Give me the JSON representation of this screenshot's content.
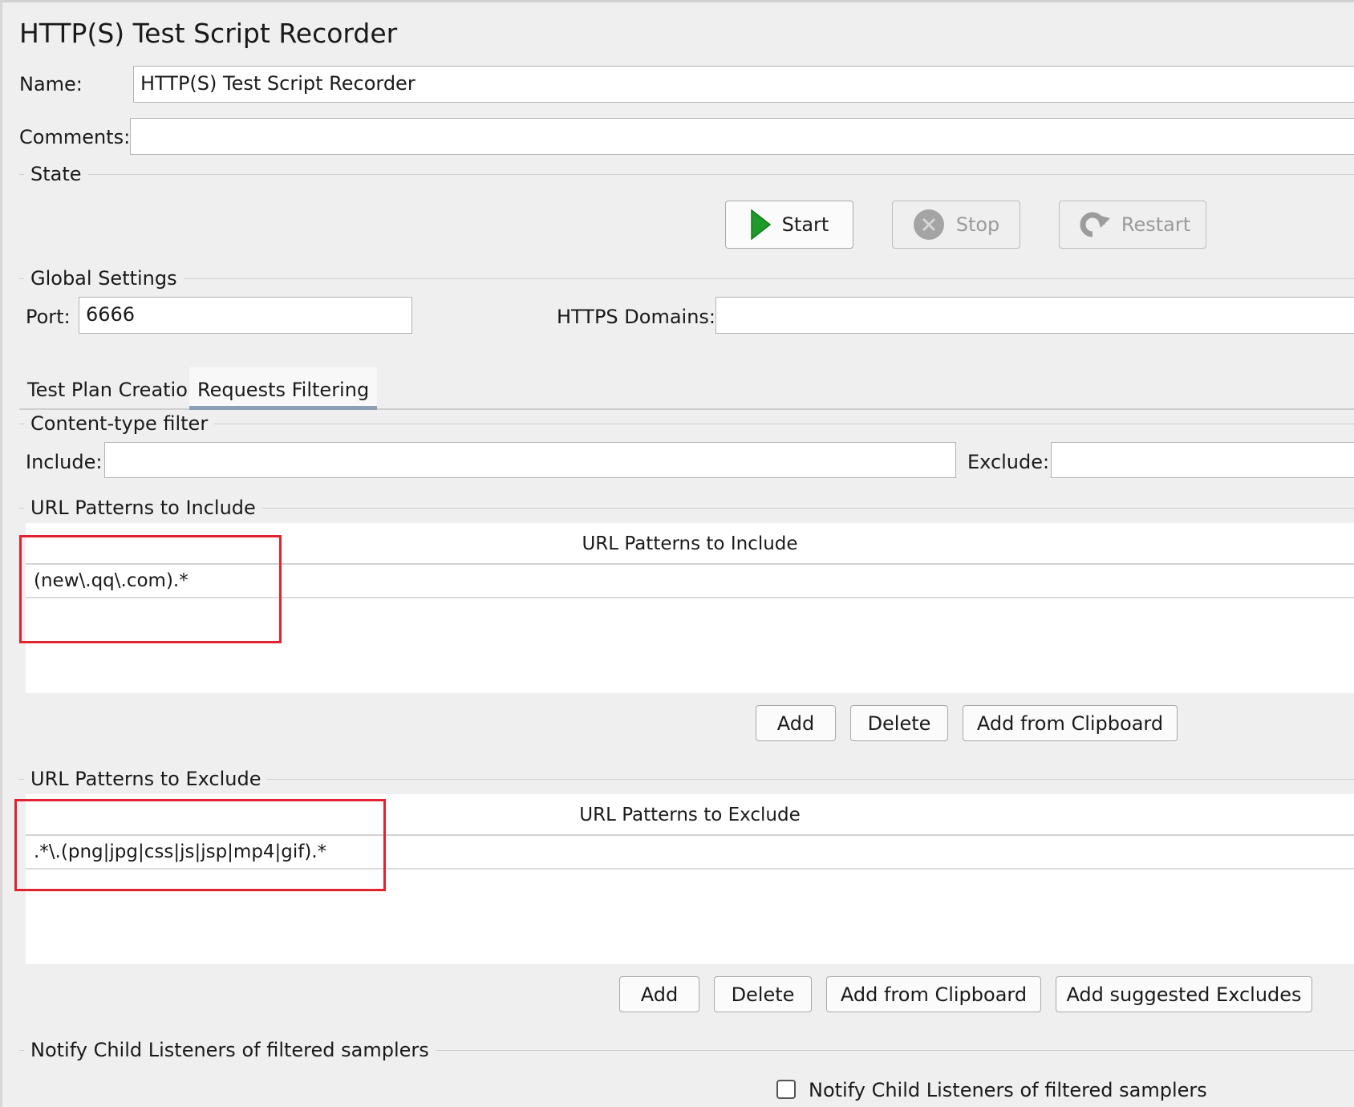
{
  "title": "HTTP(S) Test Script Recorder",
  "name_label": "Name:",
  "name_value": "HTTP(S) Test Script Recorder",
  "comments_label": "Comments:",
  "comments_value": "",
  "state": {
    "legend": "State",
    "start_label": "Start",
    "stop_label": "Stop",
    "restart_label": "Restart"
  },
  "global_settings": {
    "legend": "Global Settings",
    "port_label": "Port:",
    "port_value": "6666",
    "https_domains_label": "HTTPS Domains:",
    "https_domains_value": ""
  },
  "tabs": [
    {
      "label": "Test Plan Creation",
      "active": false
    },
    {
      "label": "Requests Filtering",
      "active": true
    }
  ],
  "content_type_filter": {
    "legend": "Content-type filter",
    "include_label": "Include:",
    "include_value": "",
    "exclude_label": "Exclude:",
    "exclude_value": ""
  },
  "include_patterns": {
    "legend": "URL Patterns to Include",
    "column_header": "URL Patterns to Include",
    "rows": [
      "(new\\.qq\\.com).*"
    ],
    "buttons": {
      "add": "Add",
      "delete": "Delete",
      "add_clipboard": "Add from Clipboard"
    }
  },
  "exclude_patterns": {
    "legend": "URL Patterns to Exclude",
    "column_header": "URL Patterns to Exclude",
    "rows": [
      ".*\\.(png|jpg|css|js|jsp|mp4|gif).*"
    ],
    "buttons": {
      "add": "Add",
      "delete": "Delete",
      "add_clipboard": "Add from Clipboard",
      "add_suggested": "Add suggested Excludes"
    }
  },
  "notify": {
    "legend": "Notify Child Listeners of filtered samplers",
    "checkbox_label": "Notify Child Listeners of filtered samplers",
    "checked": false
  },
  "colors": {
    "highlight_box": "#e0232d",
    "start_icon": "#1f9a2a",
    "tab_underline": "#8e9fb5"
  }
}
